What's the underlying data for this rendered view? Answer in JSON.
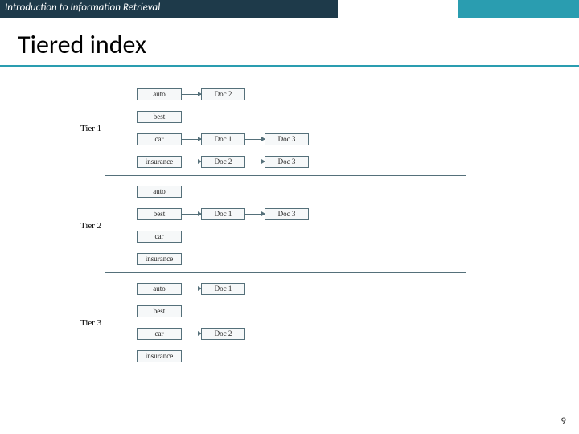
{
  "header": {
    "course": "Introduction to Information Retrieval"
  },
  "title": "Tiered index",
  "page_number": "9",
  "tiers": [
    {
      "label": "Tier 1",
      "rows": [
        {
          "term": "auto",
          "docs": [
            "Doc 2"
          ]
        },
        {
          "term": "best",
          "docs": []
        },
        {
          "term": "car",
          "docs": [
            "Doc 1",
            "Doc 3"
          ]
        },
        {
          "term": "insurance",
          "docs": [
            "Doc 2",
            "Doc 3"
          ]
        }
      ]
    },
    {
      "label": "Tier 2",
      "rows": [
        {
          "term": "auto",
          "docs": []
        },
        {
          "term": "best",
          "docs": [
            "Doc 1",
            "Doc 3"
          ]
        },
        {
          "term": "car",
          "docs": []
        },
        {
          "term": "insurance",
          "docs": []
        }
      ]
    },
    {
      "label": "Tier 3",
      "rows": [
        {
          "term": "auto",
          "docs": [
            "Doc 1"
          ]
        },
        {
          "term": "best",
          "docs": []
        },
        {
          "term": "car",
          "docs": [
            "Doc 2"
          ]
        },
        {
          "term": "insurance",
          "docs": []
        }
      ]
    }
  ]
}
